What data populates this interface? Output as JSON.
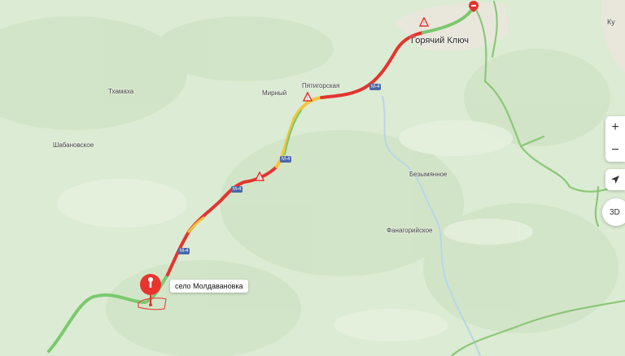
{
  "map": {
    "places": [
      {
        "name": "Горячий Ключ",
        "kind": "city"
      },
      {
        "name": "Пятигорская",
        "kind": "village"
      },
      {
        "name": "Мирный",
        "kind": "village"
      },
      {
        "name": "Тхамаха",
        "kind": "village"
      },
      {
        "name": "Шабановское",
        "kind": "village"
      },
      {
        "name": "Безымянное",
        "kind": "village"
      },
      {
        "name": "Фанагорийское",
        "kind": "village"
      },
      {
        "name": "Ку",
        "kind": "village"
      }
    ],
    "road_shield": "М-4",
    "selected_place": "село Молдавановка",
    "controls": {
      "zoom_in": "+",
      "zoom_out": "−",
      "three_d": "3D"
    },
    "colors": {
      "land": "#dcebd3",
      "road_outline": "#8cc77a",
      "traffic_red": "#e3342f",
      "traffic_yellow": "#f2c53d",
      "traffic_green": "#7bc96f",
      "pin": "#e8342f",
      "shield": "#4a67a8"
    },
    "icons": [
      "warning-icon",
      "location-pin-icon",
      "navigation-arrow-icon"
    ]
  }
}
